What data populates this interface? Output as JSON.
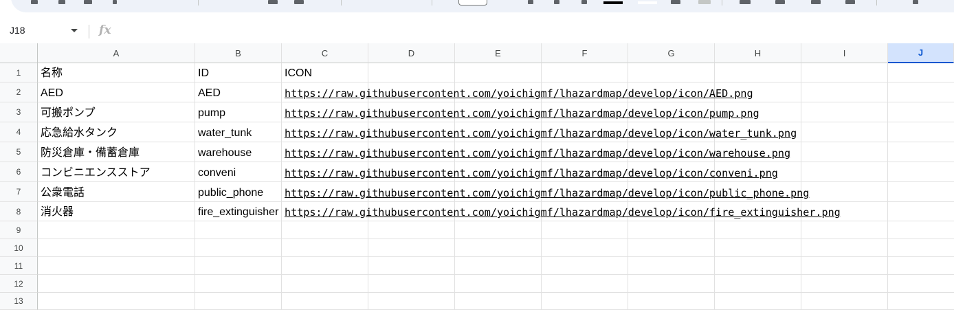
{
  "formula_bar": {
    "cell_ref": "J18",
    "fx_label": "fx"
  },
  "columns": [
    "A",
    "B",
    "C",
    "D",
    "E",
    "F",
    "G",
    "H",
    "I",
    "J"
  ],
  "selected_column": "J",
  "rows": [
    "1",
    "2",
    "3",
    "4",
    "5",
    "6",
    "7",
    "8",
    "9",
    "10",
    "11",
    "12",
    "13"
  ],
  "cells": {
    "A": [
      "名称",
      "AED",
      "可搬ポンプ",
      "応急給水タンク",
      "防災倉庫・備蓄倉庫",
      "コンビニエンスストア",
      "公衆電話",
      "消火器"
    ],
    "B": [
      "ID",
      "AED",
      "pump",
      "water_tunk",
      "warehouse",
      "conveni",
      "public_phone",
      "fire_extinguisher"
    ],
    "C": [
      "ICON",
      "https://raw.githubusercontent.com/yoichigmf/lhazardmap/develop/icon/AED.png",
      "https://raw.githubusercontent.com/yoichigmf/lhazardmap/develop/icon/pump.png",
      "https://raw.githubusercontent.com/yoichigmf/lhazardmap/develop/icon/water_tunk.png",
      "https://raw.githubusercontent.com/yoichigmf/lhazardmap/develop/icon/warehouse.png",
      "https://raw.githubusercontent.com/yoichigmf/lhazardmap/develop/icon/conveni.png",
      "https://raw.githubusercontent.com/yoichigmf/lhazardmap/develop/icon/public_phone.png",
      "https://raw.githubusercontent.com/yoichigmf/lhazardmap/develop/icon/fire_extinguisher.png"
    ]
  },
  "colors": {
    "selected_header_bg": "#d3e3fd",
    "selected_header_text": "#0b57d0",
    "header_bg": "#f8f9fa",
    "gridline": "#e1e1e1"
  }
}
